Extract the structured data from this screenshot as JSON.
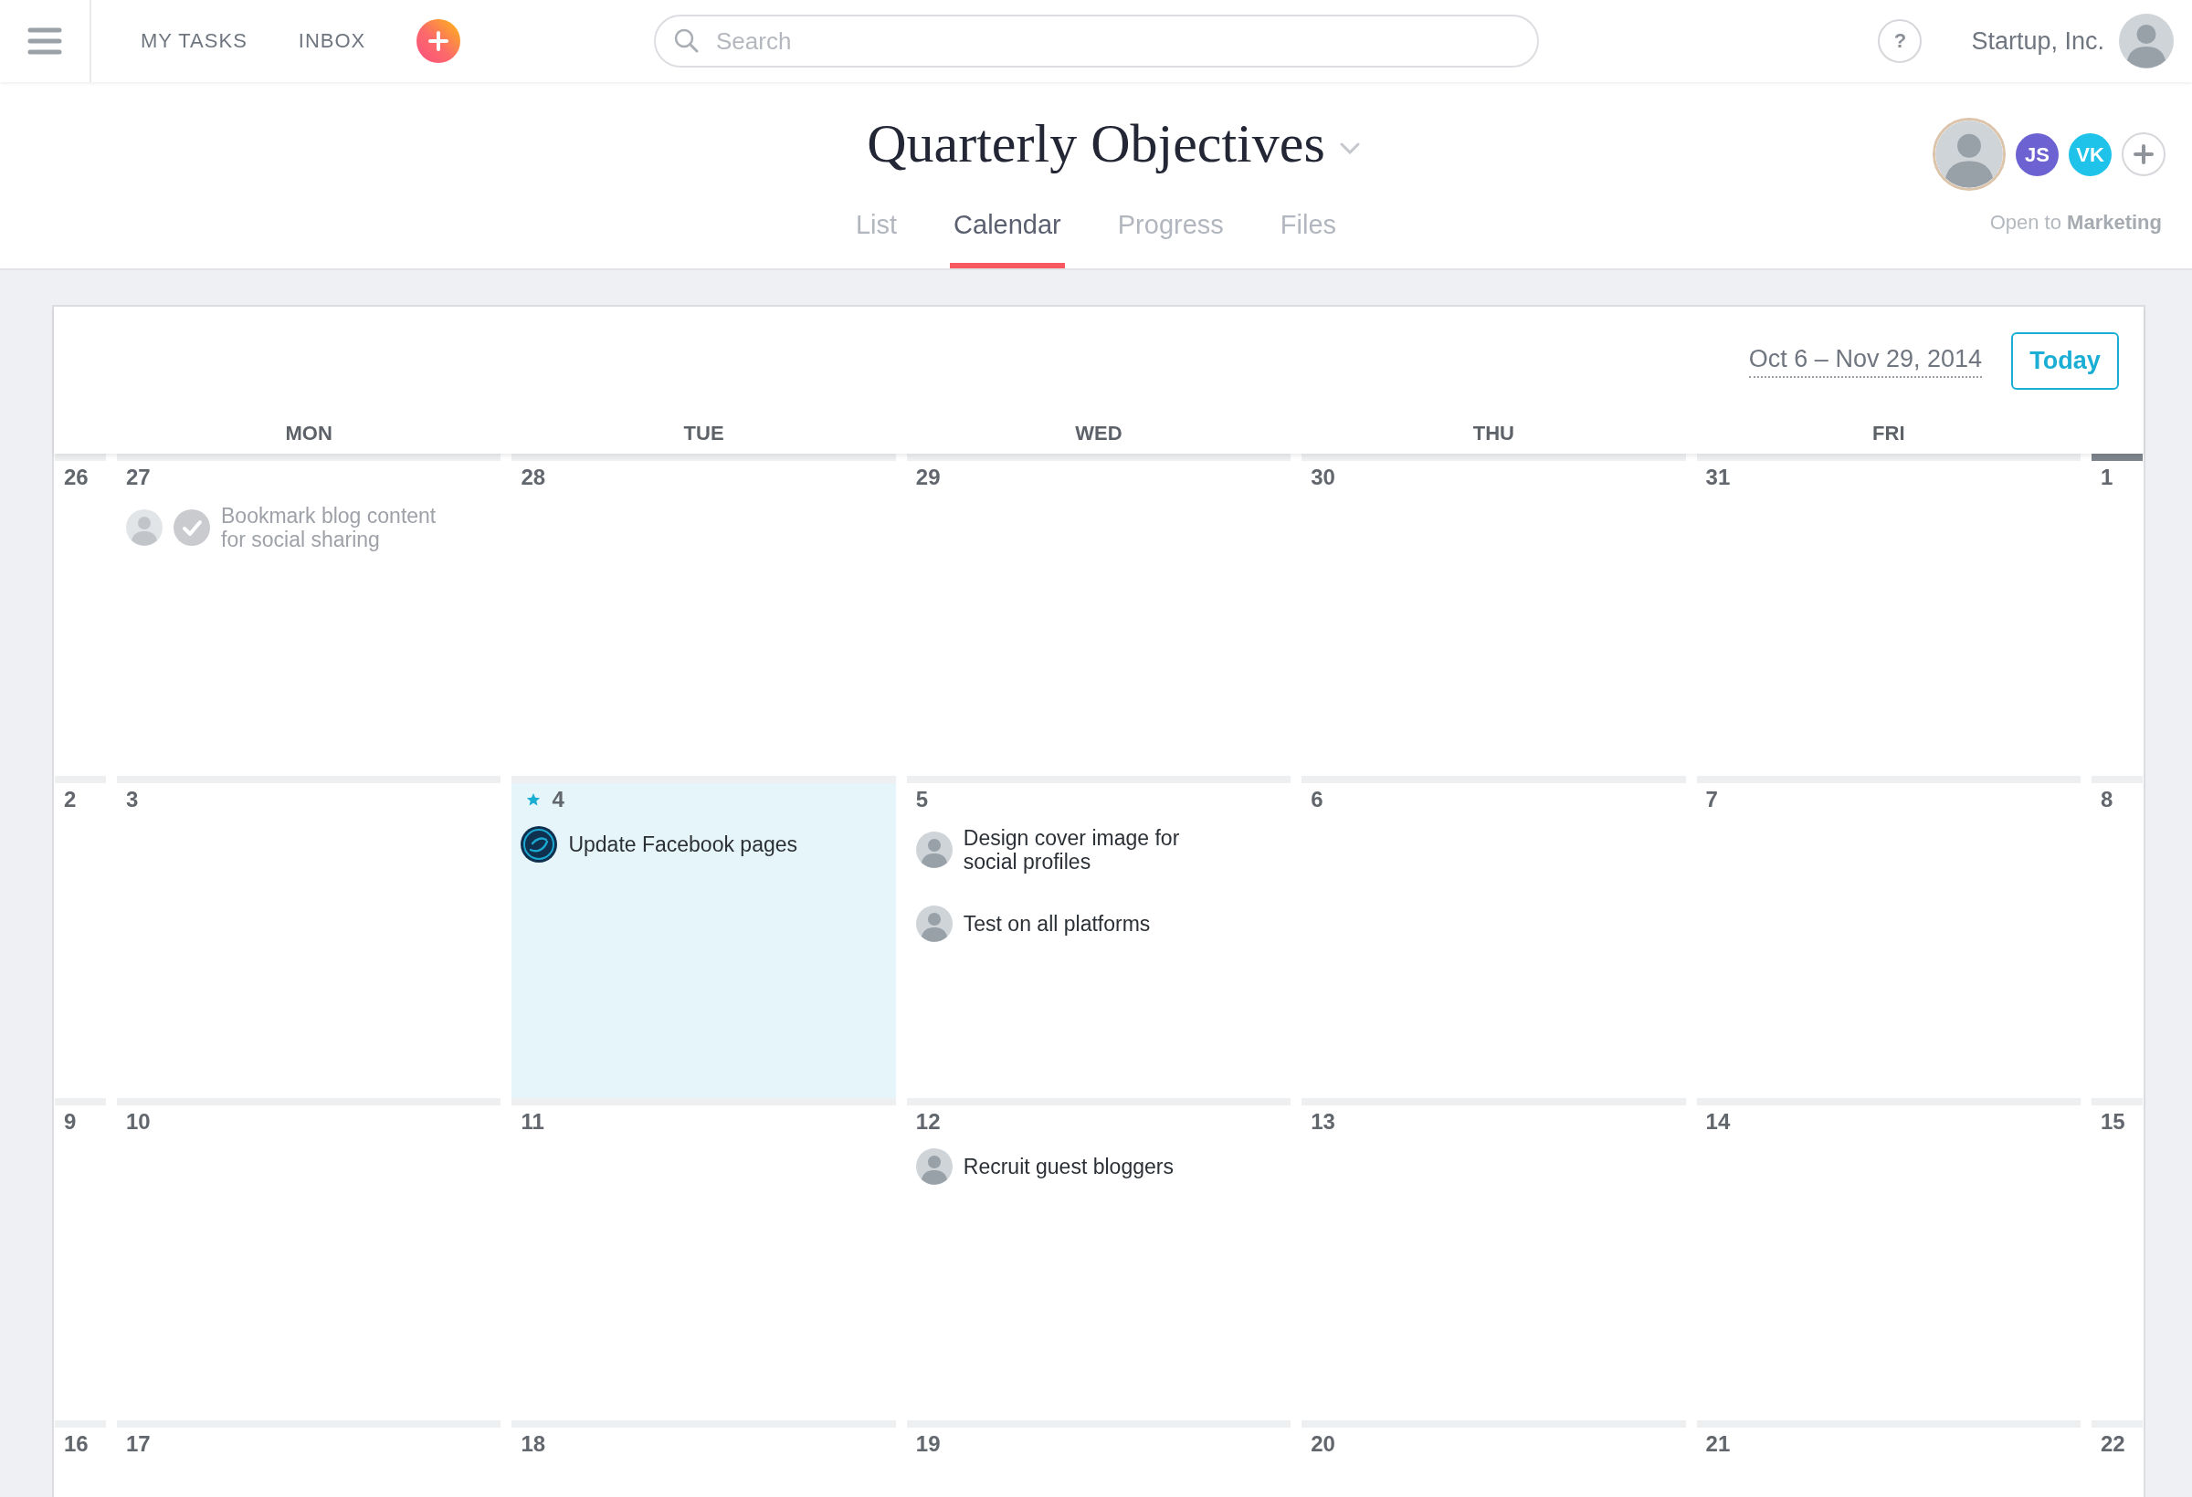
{
  "topbar": {
    "nav": [
      "MY TASKS",
      "INBOX"
    ],
    "search": {
      "placeholder": "Search"
    },
    "help": "?",
    "workspace": "Startup, Inc."
  },
  "project": {
    "title": "Quarterly Objectives",
    "tabs": [
      {
        "label": "List",
        "selected": false
      },
      {
        "label": "Calendar",
        "selected": true
      },
      {
        "label": "Progress",
        "selected": false
      },
      {
        "label": "Files",
        "selected": false
      }
    ],
    "members": [
      {
        "kind": "photo"
      },
      {
        "kind": "initials",
        "initials": "JS",
        "color": "#6c62d1"
      },
      {
        "kind": "initials",
        "initials": "VK",
        "color": "#1fc3e9"
      }
    ],
    "sharing": "Open to **Marketing**"
  },
  "calendar": {
    "date_range": "Oct 6 – Nov 29, 2014",
    "today_button": "Today",
    "weekdays": [
      "MON",
      "TUE",
      "WED",
      "THU",
      "FRI"
    ],
    "weeks": [
      {
        "days": [
          {
            "number": "26",
            "today": false,
            "marked": false
          },
          {
            "number": "27",
            "today": false,
            "marked": false,
            "events": [
              {
                "title": "Bookmark blog content for social sharing",
                "kind": "photo",
                "completed": true
              }
            ]
          },
          {
            "number": "28",
            "today": false,
            "marked": false
          },
          {
            "number": "29",
            "today": false,
            "marked": false
          },
          {
            "number": "30",
            "today": false,
            "marked": false
          },
          {
            "number": "31",
            "today": false,
            "marked": false
          },
          {
            "number": "1",
            "today": false,
            "marked": true
          }
        ]
      },
      {
        "days": [
          {
            "number": "2",
            "today": false,
            "marked": false
          },
          {
            "number": "3",
            "today": false,
            "marked": false
          },
          {
            "number": "4",
            "today": true,
            "marked": false,
            "events": [
              {
                "title": "Update Facebook pages",
                "kind": "logo",
                "completed": false
              }
            ]
          },
          {
            "number": "5",
            "today": false,
            "marked": false,
            "events": [
              {
                "title": "Design cover image for social profiles",
                "kind": "photo",
                "completed": false
              },
              {
                "title": "Test on all platforms",
                "kind": "photo",
                "completed": false
              }
            ]
          },
          {
            "number": "6",
            "today": false,
            "marked": false
          },
          {
            "number": "7",
            "today": false,
            "marked": false
          },
          {
            "number": "8",
            "today": false,
            "marked": false
          }
        ]
      },
      {
        "days": [
          {
            "number": "9",
            "today": false,
            "marked": false
          },
          {
            "number": "10",
            "today": false,
            "marked": false
          },
          {
            "number": "11",
            "today": false,
            "marked": false
          },
          {
            "number": "12",
            "today": false,
            "marked": false,
            "events": [
              {
                "title": "Recruit guest bloggers",
                "kind": "photo",
                "completed": false
              }
            ]
          },
          {
            "number": "13",
            "today": false,
            "marked": false
          },
          {
            "number": "14",
            "today": false,
            "marked": false
          },
          {
            "number": "15",
            "today": false,
            "marked": false
          }
        ]
      },
      {
        "days": [
          {
            "number": "16",
            "today": false,
            "marked": false
          },
          {
            "number": "17",
            "today": false,
            "marked": false
          },
          {
            "number": "18",
            "today": false,
            "marked": false
          },
          {
            "number": "19",
            "today": false,
            "marked": false
          },
          {
            "number": "20",
            "today": false,
            "marked": false
          },
          {
            "number": "21",
            "today": false,
            "marked": false
          },
          {
            "number": "22",
            "today": false,
            "marked": false
          }
        ]
      }
    ]
  }
}
